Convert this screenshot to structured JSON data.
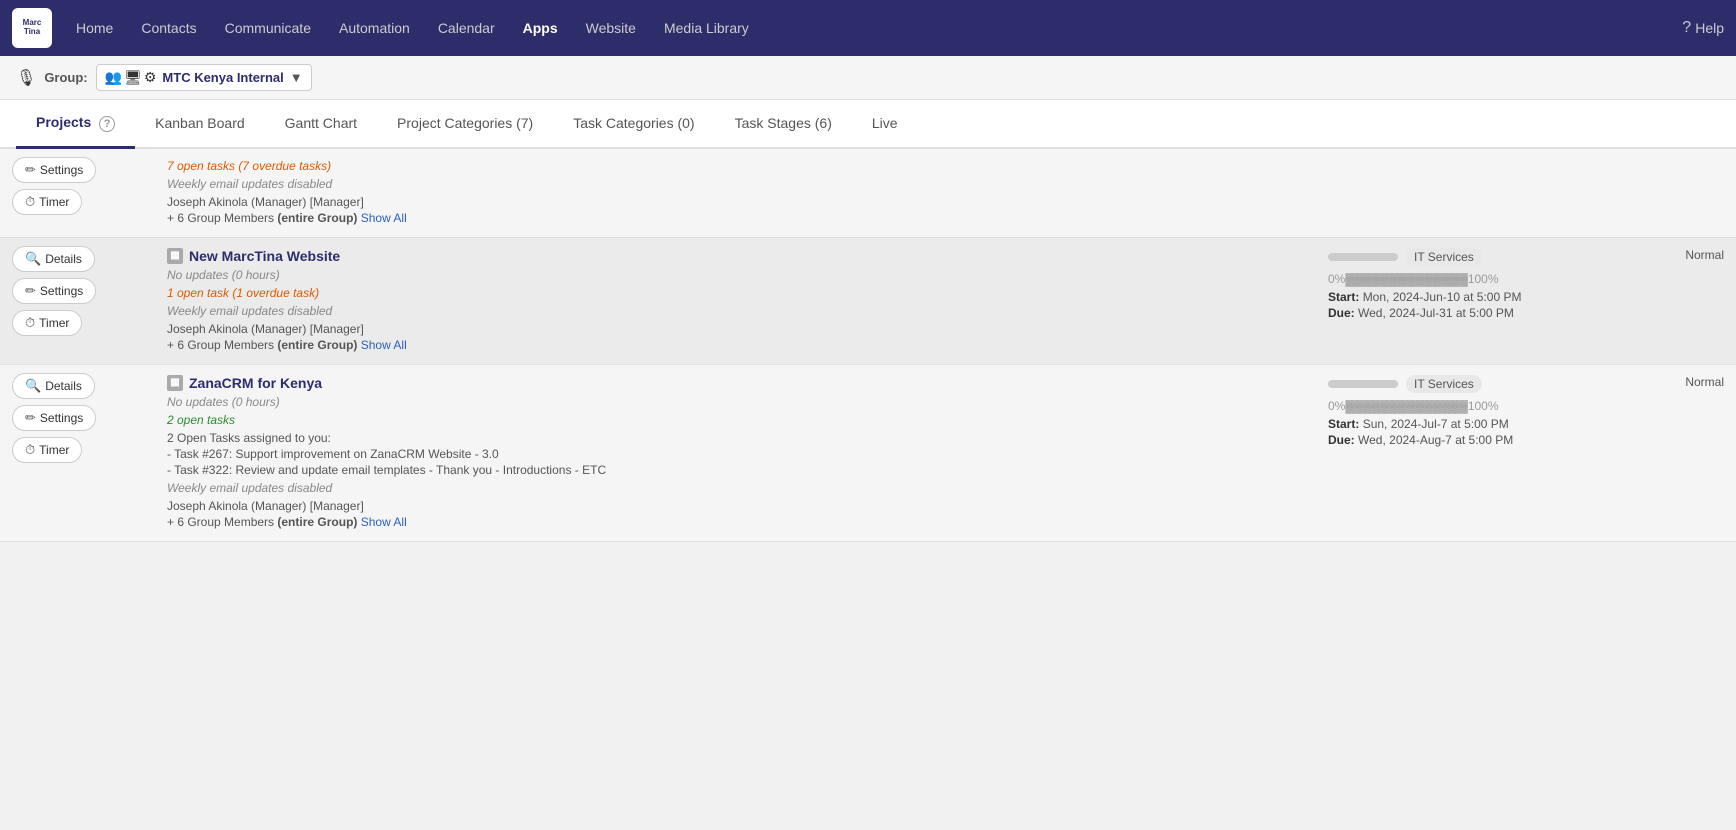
{
  "nav": {
    "logo_text": "Marc\nTina",
    "items": [
      {
        "label": "Home",
        "active": false
      },
      {
        "label": "Contacts",
        "active": false
      },
      {
        "label": "Communicate",
        "active": false
      },
      {
        "label": "Automation",
        "active": false
      },
      {
        "label": "Calendar",
        "active": false
      },
      {
        "label": "Apps",
        "active": true
      },
      {
        "label": "Website",
        "active": false
      },
      {
        "label": "Media Library",
        "active": false
      }
    ],
    "help_label": "Help"
  },
  "group_bar": {
    "label": "Group:",
    "name": "MTC Kenya Internal",
    "chevron": "▼"
  },
  "sub_nav": {
    "tabs": [
      {
        "label": "Projects",
        "active": true,
        "has_help": true
      },
      {
        "label": "Kanban Board",
        "active": false
      },
      {
        "label": "Gantt Chart",
        "active": false
      },
      {
        "label": "Project Categories (7)",
        "active": false
      },
      {
        "label": "Task Categories (0)",
        "active": false
      },
      {
        "label": "Task Stages (6)",
        "active": false
      },
      {
        "label": "Live",
        "active": false
      }
    ]
  },
  "partial_top": {
    "tasks_open": "7 open tasks",
    "tasks_overdue": "(7 overdue tasks)",
    "email_updates": "Weekly email updates disabled",
    "manager": "Joseph Akinola (Manager) [Manager]",
    "members": "+ 6 Group Members",
    "entire_group": "(entire Group)",
    "show_all": "Show All"
  },
  "projects": [
    {
      "id": "new-marctina",
      "icon": "▦",
      "title": "New MarcTina Website",
      "updates": "No updates (0 hours)",
      "tasks_open": "1 open task (1 overdue task)",
      "tasks_type": "overdue",
      "email_updates": "Weekly email updates disabled",
      "manager": "Joseph Akinola (Manager) [Manager]",
      "members": "+ 6 Group Members",
      "entire_group": "(entire Group)",
      "show_all": "Show All",
      "progress_pct": 0,
      "progress_text": "0%▓▓▓▓▓▓▓▓▓▓▓▓▓▓100%",
      "category": "IT Services",
      "start_label": "Start:",
      "start_date": "Mon, 2024-Jun-10 at 5:00 PM",
      "due_label": "Due:",
      "due_date": "Wed, 2024-Jul-31 at 5:00 PM",
      "priority": "Normal",
      "open_tasks_list": []
    },
    {
      "id": "zanacrm",
      "icon": "▦",
      "title": "ZanaCRM for Kenya",
      "updates": "No updates (0 hours)",
      "tasks_open": "2 open tasks",
      "tasks_type": "open",
      "email_updates": "Weekly email updates disabled",
      "manager": "Joseph Akinola (Manager) [Manager]",
      "members": "+ 6 Group Members",
      "entire_group": "(entire Group)",
      "show_all": "Show All",
      "progress_pct": 0,
      "progress_text": "0%▓▓▓▓▓▓▓▓▓▓▓▓▓▓100%",
      "category": "IT Services",
      "start_label": "Start:",
      "start_date": "Sun, 2024-Jul-7 at 5:00 PM",
      "due_label": "Due:",
      "due_date": "Wed, 2024-Aug-7 at 5:00 PM",
      "priority": "Normal",
      "open_tasks_header": "2 Open Tasks assigned to you:",
      "open_tasks_list": [
        "- Task #267: Support improvement on ZanaCRM Website - 3.0",
        "- Task #322: Review and update email templates - Thank you - Introductions - ETC"
      ]
    }
  ],
  "buttons": {
    "details": "Details",
    "settings": "Settings",
    "timer": "Timer"
  }
}
